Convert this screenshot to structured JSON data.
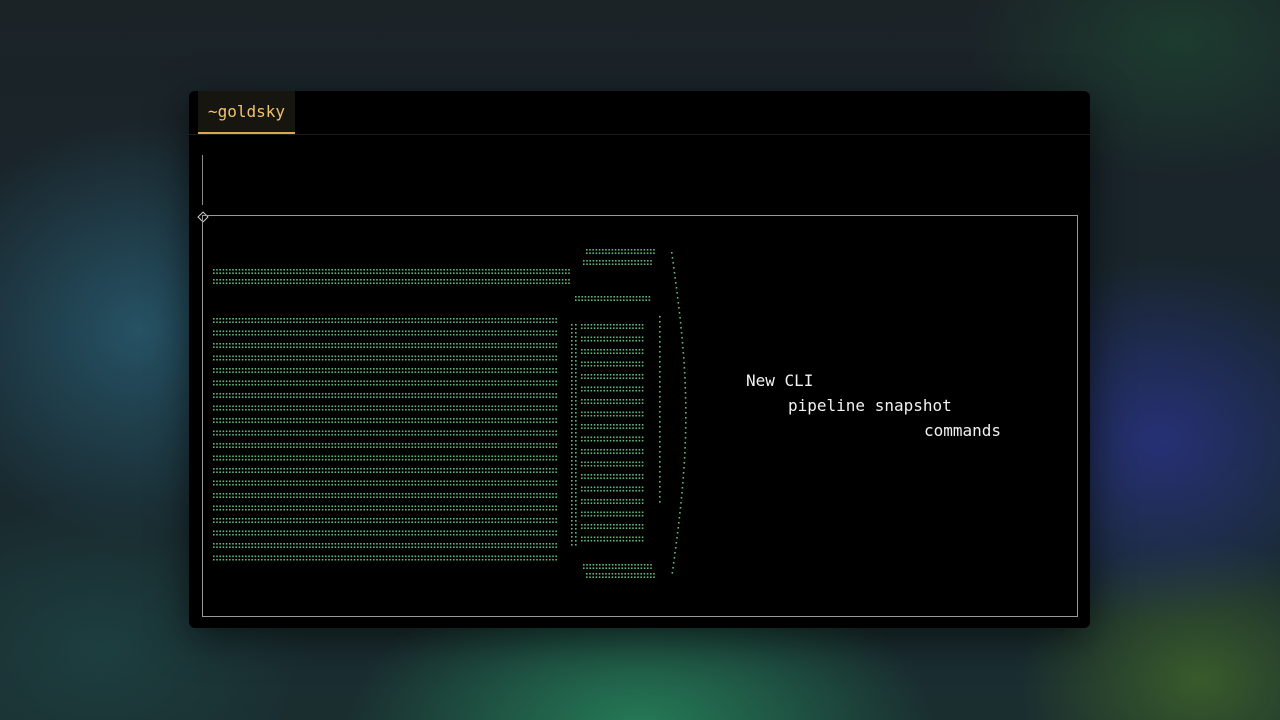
{
  "tab": {
    "title": "~goldsky"
  },
  "art": {
    "color": "#62b87a"
  },
  "message": {
    "line1": "New CLI",
    "line2": "pipeline snapshot",
    "line3": "commands"
  },
  "colors": {
    "tab_accent": "#d9a94a",
    "tab_text": "#f0c56a",
    "frame_border": "#9a9a9a",
    "text": "#f2f2f2"
  }
}
